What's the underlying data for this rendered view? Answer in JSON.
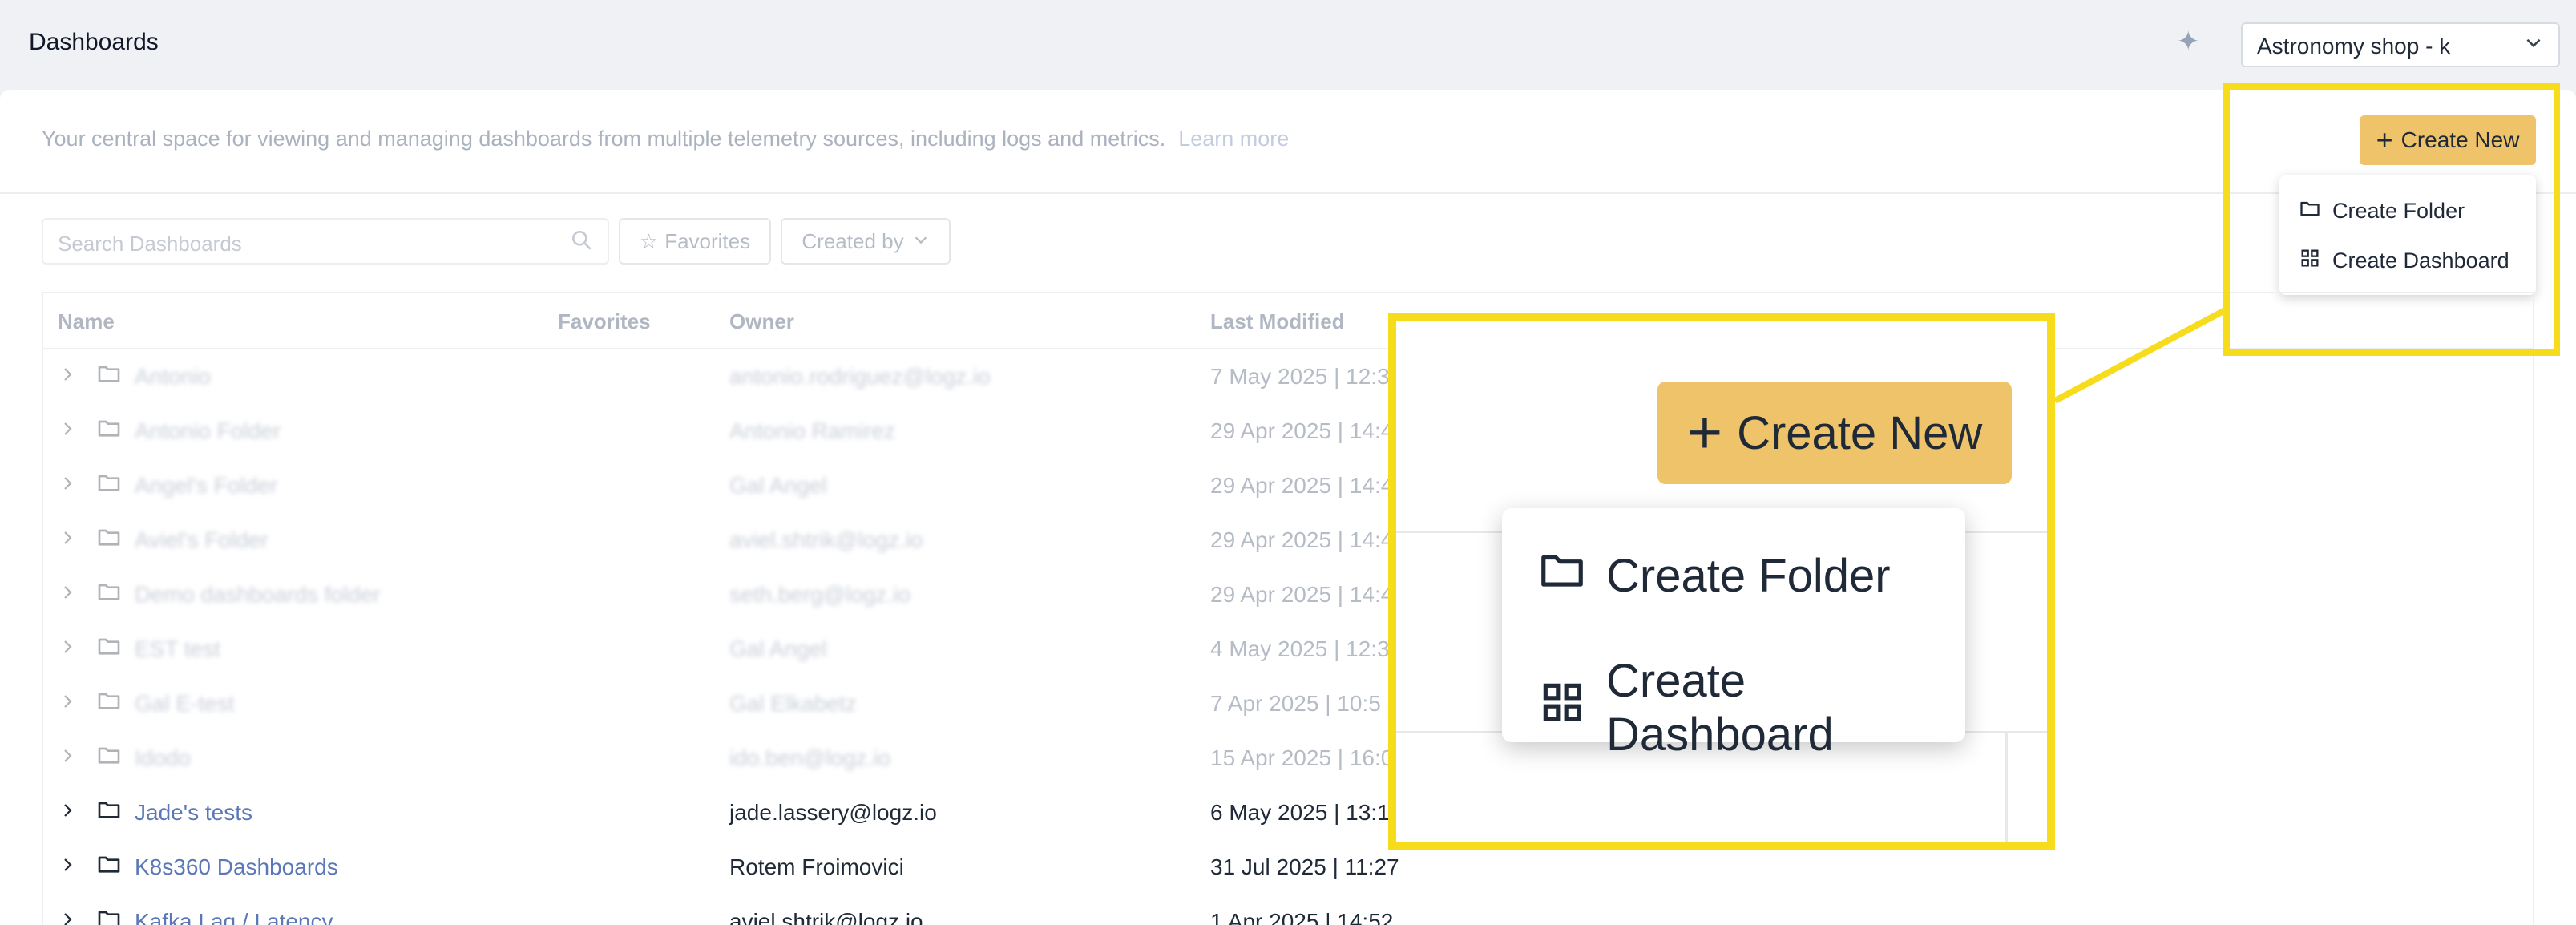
{
  "header": {
    "title": "Dashboards",
    "account_select": "Astronomy shop - k",
    "sparkle_icon": "sparkle-icon"
  },
  "intro": {
    "description": "Your central space for viewing and managing dashboards from multiple telemetry sources, including logs and metrics.",
    "learn_more": "Learn more"
  },
  "create_new": {
    "label": "Create New",
    "menu": [
      "Create Folder",
      "Create Dashboard"
    ]
  },
  "filters": {
    "search_placeholder": "Search Dashboards",
    "favorites_label": "Favorites",
    "created_by_label": "Created by"
  },
  "table": {
    "columns": [
      "Name",
      "Favorites",
      "Owner",
      "Last Modified"
    ],
    "rows": [
      {
        "name": "Antonio",
        "owner": "antonio.rodriguez@logz.io",
        "modified": "7 May 2025 | 12:3"
      },
      {
        "name": "Antonio Folder",
        "owner": "Antonio Ramirez",
        "modified": "29 Apr 2025 | 14:4"
      },
      {
        "name": "Angel's Folder",
        "owner": "Gal Angel",
        "modified": "29 Apr 2025 | 14:4"
      },
      {
        "name": "Aviel's Folder",
        "owner": "aviel.shtrik@logz.io",
        "modified": "29 Apr 2025 | 14:4"
      },
      {
        "name": "Demo dashboards folder",
        "owner": "seth.berg@logz.io",
        "modified": "29 Apr 2025 | 14:4"
      },
      {
        "name": "EST test",
        "owner": "Gal Angel",
        "modified": "4 May 2025 | 12:3"
      },
      {
        "name": "Gal E-test",
        "owner": "Gal Elkabetz",
        "modified": "7 Apr 2025 | 10:5"
      },
      {
        "name": "Idodo",
        "owner": "ido.ben@logz.io",
        "modified": "15 Apr 2025 | 16:0"
      },
      {
        "name": "Jade's tests",
        "owner": "jade.lassery@logz.io",
        "modified": "6 May 2025 | 13:1"
      },
      {
        "name": "K8s360 Dashboards",
        "owner": "Rotem Froimovici",
        "modified": "31 Jul 2025 | 11:27"
      },
      {
        "name": "Kafka Lag / Latency",
        "owner": "aviel.shtrik@logz.io",
        "modified": "1 Apr 2025 | 14:52"
      }
    ]
  },
  "zoom": {
    "create_new": "Create New",
    "menu": [
      "Create Folder",
      "Create Dashboard"
    ]
  },
  "colors": {
    "accent": "#efc36a",
    "callout": "#f7dc1c",
    "link": "#5a78b8"
  }
}
